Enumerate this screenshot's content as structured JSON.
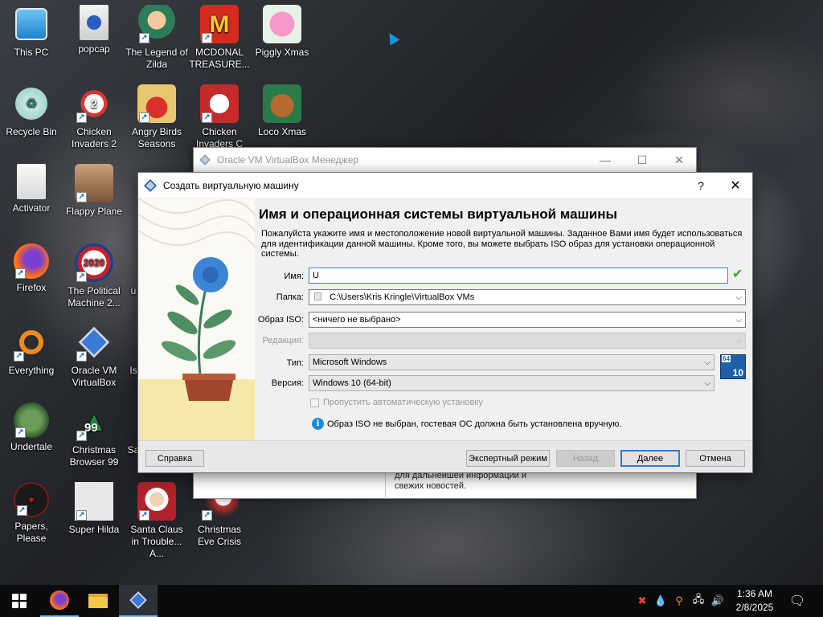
{
  "desktop": {
    "icons": [
      {
        "label": "This PC"
      },
      {
        "label": "popcap"
      },
      {
        "label": "The Legend of Zilda"
      },
      {
        "label": "MCDONAL TREASURE..."
      },
      {
        "label": "Piggly Xmas"
      },
      {
        "label": "Recycle Bin"
      },
      {
        "label": "Chicken Invaders 2"
      },
      {
        "label": "Angry Birds Seasons"
      },
      {
        "label": "Chicken Invaders C"
      },
      {
        "label": "Loco Xmas"
      },
      {
        "label": "Activator"
      },
      {
        "label": "Flappy Plane"
      },
      {
        "label": "Firefox"
      },
      {
        "label": "The Political Machine 2..."
      },
      {
        "label": "u"
      },
      {
        "label": "Everything"
      },
      {
        "label": "Oracle VM VirtualBox"
      },
      {
        "label": "Is"
      },
      {
        "label": "Undertale"
      },
      {
        "label": "Christmas Browser 99"
      },
      {
        "label": "Sa"
      },
      {
        "label": "Papers, Please"
      },
      {
        "label": "Super Hilda"
      },
      {
        "label": "Santa Claus in Trouble... A..."
      },
      {
        "label": "Christmas Eve Crisis"
      }
    ]
  },
  "manager": {
    "title": "Oracle VM VirtualBox Менеджер",
    "bottom_text": "для дальнейшей информации и свежих новостей."
  },
  "dialog": {
    "title": "Создать виртуальную машину",
    "help": "?",
    "close": "✕",
    "heading": "Имя и операционная системы виртуальной машины",
    "description": "Пожалуйста укажите имя и местоположение новой виртуальной машины. Заданное Вами имя будет использоваться для идентификации данной машины. Кроме того, вы можете выбрать ISO образ для установки операционной системы.",
    "fields": {
      "name_label": "Имя:",
      "name_value": "U",
      "folder_label": "Папка:",
      "folder_value": "C:\\Users\\Kris Kringle\\VirtualBox VMs",
      "iso_label": "Образ ISO:",
      "iso_value": "<ничего не выбрано>",
      "edition_label": "Редакция:",
      "type_label": "Тип:",
      "type_value": "Microsoft Windows",
      "version_label": "Версия:",
      "version_value": "Windows 10 (64-bit)",
      "os_badge_bits": "64",
      "os_badge_ver": "10"
    },
    "skip_unattended": "Пропустить автоматическую установку",
    "info_text": "Образ ISO не выбран, гостевая ОС должна быть установлена вручную.",
    "buttons": {
      "help": "Справка",
      "expert": "Экспертный режим",
      "back": "Назад",
      "next": "Далее",
      "cancel": "Отмена"
    }
  },
  "taskbar": {
    "time": "1:36 AM",
    "date": "2/8/2025"
  }
}
